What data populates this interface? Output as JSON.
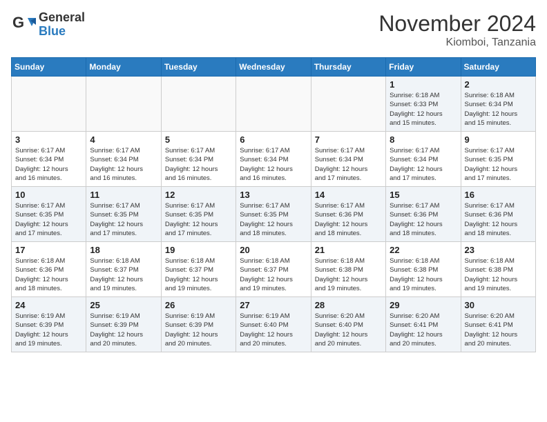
{
  "header": {
    "logo_general": "General",
    "logo_blue": "Blue",
    "title": "November 2024",
    "subtitle": "Kiomboi, Tanzania"
  },
  "weekdays": [
    "Sunday",
    "Monday",
    "Tuesday",
    "Wednesday",
    "Thursday",
    "Friday",
    "Saturday"
  ],
  "weeks": [
    [
      {
        "day": "",
        "info": ""
      },
      {
        "day": "",
        "info": ""
      },
      {
        "day": "",
        "info": ""
      },
      {
        "day": "",
        "info": ""
      },
      {
        "day": "",
        "info": ""
      },
      {
        "day": "1",
        "info": "Sunrise: 6:18 AM\nSunset: 6:33 PM\nDaylight: 12 hours\nand 15 minutes."
      },
      {
        "day": "2",
        "info": "Sunrise: 6:18 AM\nSunset: 6:34 PM\nDaylight: 12 hours\nand 15 minutes."
      }
    ],
    [
      {
        "day": "3",
        "info": "Sunrise: 6:17 AM\nSunset: 6:34 PM\nDaylight: 12 hours\nand 16 minutes."
      },
      {
        "day": "4",
        "info": "Sunrise: 6:17 AM\nSunset: 6:34 PM\nDaylight: 12 hours\nand 16 minutes."
      },
      {
        "day": "5",
        "info": "Sunrise: 6:17 AM\nSunset: 6:34 PM\nDaylight: 12 hours\nand 16 minutes."
      },
      {
        "day": "6",
        "info": "Sunrise: 6:17 AM\nSunset: 6:34 PM\nDaylight: 12 hours\nand 16 minutes."
      },
      {
        "day": "7",
        "info": "Sunrise: 6:17 AM\nSunset: 6:34 PM\nDaylight: 12 hours\nand 17 minutes."
      },
      {
        "day": "8",
        "info": "Sunrise: 6:17 AM\nSunset: 6:34 PM\nDaylight: 12 hours\nand 17 minutes."
      },
      {
        "day": "9",
        "info": "Sunrise: 6:17 AM\nSunset: 6:35 PM\nDaylight: 12 hours\nand 17 minutes."
      }
    ],
    [
      {
        "day": "10",
        "info": "Sunrise: 6:17 AM\nSunset: 6:35 PM\nDaylight: 12 hours\nand 17 minutes."
      },
      {
        "day": "11",
        "info": "Sunrise: 6:17 AM\nSunset: 6:35 PM\nDaylight: 12 hours\nand 17 minutes."
      },
      {
        "day": "12",
        "info": "Sunrise: 6:17 AM\nSunset: 6:35 PM\nDaylight: 12 hours\nand 17 minutes."
      },
      {
        "day": "13",
        "info": "Sunrise: 6:17 AM\nSunset: 6:35 PM\nDaylight: 12 hours\nand 18 minutes."
      },
      {
        "day": "14",
        "info": "Sunrise: 6:17 AM\nSunset: 6:36 PM\nDaylight: 12 hours\nand 18 minutes."
      },
      {
        "day": "15",
        "info": "Sunrise: 6:17 AM\nSunset: 6:36 PM\nDaylight: 12 hours\nand 18 minutes."
      },
      {
        "day": "16",
        "info": "Sunrise: 6:17 AM\nSunset: 6:36 PM\nDaylight: 12 hours\nand 18 minutes."
      }
    ],
    [
      {
        "day": "17",
        "info": "Sunrise: 6:18 AM\nSunset: 6:36 PM\nDaylight: 12 hours\nand 18 minutes."
      },
      {
        "day": "18",
        "info": "Sunrise: 6:18 AM\nSunset: 6:37 PM\nDaylight: 12 hours\nand 19 minutes."
      },
      {
        "day": "19",
        "info": "Sunrise: 6:18 AM\nSunset: 6:37 PM\nDaylight: 12 hours\nand 19 minutes."
      },
      {
        "day": "20",
        "info": "Sunrise: 6:18 AM\nSunset: 6:37 PM\nDaylight: 12 hours\nand 19 minutes."
      },
      {
        "day": "21",
        "info": "Sunrise: 6:18 AM\nSunset: 6:38 PM\nDaylight: 12 hours\nand 19 minutes."
      },
      {
        "day": "22",
        "info": "Sunrise: 6:18 AM\nSunset: 6:38 PM\nDaylight: 12 hours\nand 19 minutes."
      },
      {
        "day": "23",
        "info": "Sunrise: 6:18 AM\nSunset: 6:38 PM\nDaylight: 12 hours\nand 19 minutes."
      }
    ],
    [
      {
        "day": "24",
        "info": "Sunrise: 6:19 AM\nSunset: 6:39 PM\nDaylight: 12 hours\nand 19 minutes."
      },
      {
        "day": "25",
        "info": "Sunrise: 6:19 AM\nSunset: 6:39 PM\nDaylight: 12 hours\nand 20 minutes."
      },
      {
        "day": "26",
        "info": "Sunrise: 6:19 AM\nSunset: 6:39 PM\nDaylight: 12 hours\nand 20 minutes."
      },
      {
        "day": "27",
        "info": "Sunrise: 6:19 AM\nSunset: 6:40 PM\nDaylight: 12 hours\nand 20 minutes."
      },
      {
        "day": "28",
        "info": "Sunrise: 6:20 AM\nSunset: 6:40 PM\nDaylight: 12 hours\nand 20 minutes."
      },
      {
        "day": "29",
        "info": "Sunrise: 6:20 AM\nSunset: 6:41 PM\nDaylight: 12 hours\nand 20 minutes."
      },
      {
        "day": "30",
        "info": "Sunrise: 6:20 AM\nSunset: 6:41 PM\nDaylight: 12 hours\nand 20 minutes."
      }
    ]
  ]
}
